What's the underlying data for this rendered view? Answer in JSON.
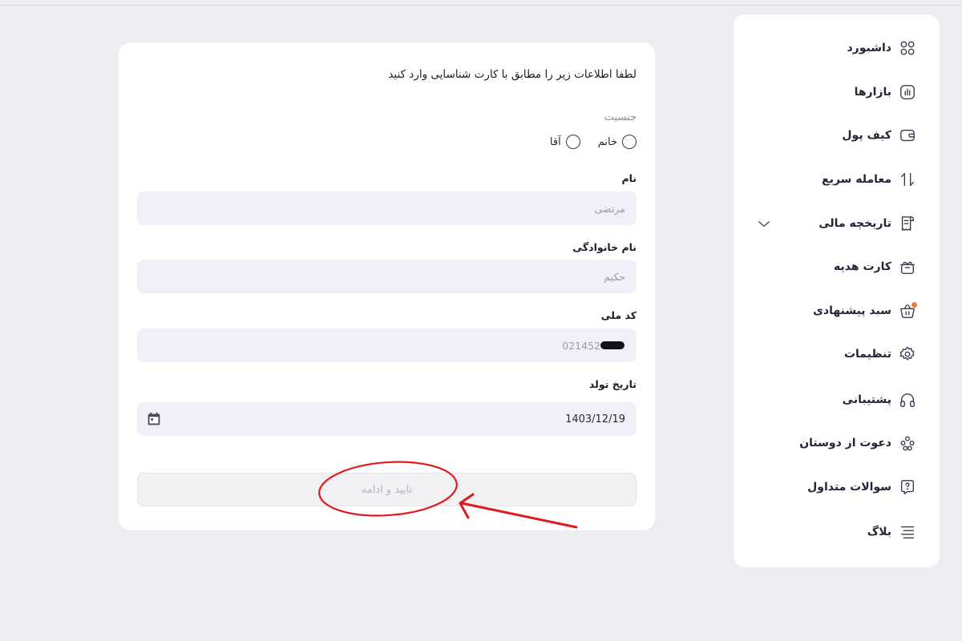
{
  "sidebar": {
    "items": [
      {
        "label": "داشبورد",
        "icon": "dashboard-icon"
      },
      {
        "label": "بازارها",
        "icon": "markets-icon"
      },
      {
        "label": "کیف پول",
        "icon": "wallet-icon"
      },
      {
        "label": "معامله سریع",
        "icon": "swap-icon"
      },
      {
        "label": "تاریخچه مالی",
        "icon": "receipt-icon"
      },
      {
        "label": "کارت هدیه",
        "icon": "gift-icon"
      },
      {
        "label": "سبد پیشنهادی",
        "icon": "basket-icon"
      },
      {
        "label": "تنظیمات",
        "icon": "gear-icon"
      },
      {
        "label": "پشتیبانی",
        "icon": "headset-icon"
      },
      {
        "label": "دعوت از دوستان",
        "icon": "users-icon"
      },
      {
        "label": "سوالات متداول",
        "icon": "question-icon"
      },
      {
        "label": "بلاگ",
        "icon": "menu-lines-icon"
      }
    ]
  },
  "form": {
    "intro": "لطفا اطلاعات زیر را مطابق با کارت شناسایی وارد کنید",
    "gender_label": "جنسیت",
    "gender_options": [
      "خانم",
      "آقا"
    ],
    "first_name_label": "نام",
    "first_name_placeholder": "مرتضی",
    "last_name_label": "نام خانوادگی",
    "last_name_placeholder": "حکیم",
    "national_code_label": "کد ملی",
    "national_code_value": "021452",
    "birth_date_label": "تاریخ تولد",
    "birth_date_value": "1403/12/19",
    "submit_label": "تایید و ادامه"
  },
  "colors": {
    "accent_annotation": "#e0191f",
    "badge": "#f47b3b",
    "field_bg": "#f0f0f9"
  }
}
